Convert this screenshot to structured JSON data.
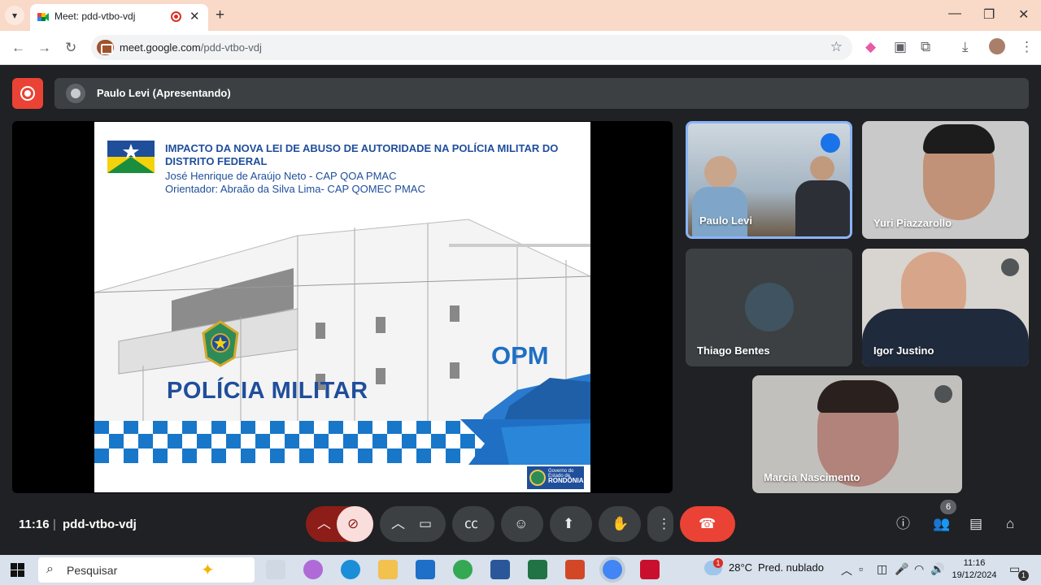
{
  "browser": {
    "tab_title": "Meet: pdd-vtbo-vdj",
    "url_domain": "meet.google.com",
    "url_path": "/pdd-vtbo-vdj"
  },
  "meet": {
    "presenter_label": "Paulo Levi (Apresentando)",
    "slide": {
      "title": "IMPACTO DA NOVA LEI DE ABUSO DE AUTORIDADE NA POLÍCIA MILITAR DO DISTRITO FEDERAL",
      "author": "José Henrique de Araújo Neto - CAP QOA PMAC",
      "advisor": "Orientador: Abraão da Silva Lima- CAP QOMEC PMAC",
      "banner": "POLÍCIA MILITAR",
      "opm": "OPM",
      "logo_small": "Governo do Estado de",
      "logo_big": "RONDÔNIA"
    },
    "participants": [
      {
        "name": "Paulo Levi",
        "status": "speaking"
      },
      {
        "name": "Yuri Piazzarollo",
        "status": "unmuted"
      },
      {
        "name": "Thiago Bentes",
        "status": "muted"
      },
      {
        "name": "Igor Justino",
        "status": "muted"
      },
      {
        "name": "Marcia Nascimento",
        "status": "muted"
      }
    ],
    "time": "11:16",
    "meeting_code": "pdd-vtbo-vdj",
    "people_count": "6"
  },
  "taskbar": {
    "search_placeholder": "Pesquisar",
    "weather_temp": "28°C",
    "weather_desc": "Pred. nublado",
    "weather_badge": "1",
    "time": "11:16",
    "date": "19/12/2024",
    "notif_count": "1"
  },
  "colors": {
    "meet_bg": "#202124",
    "end_call": "#ea4335",
    "mic_off_active": "#f9dedc",
    "slide_blue": "#1f4e9b"
  }
}
